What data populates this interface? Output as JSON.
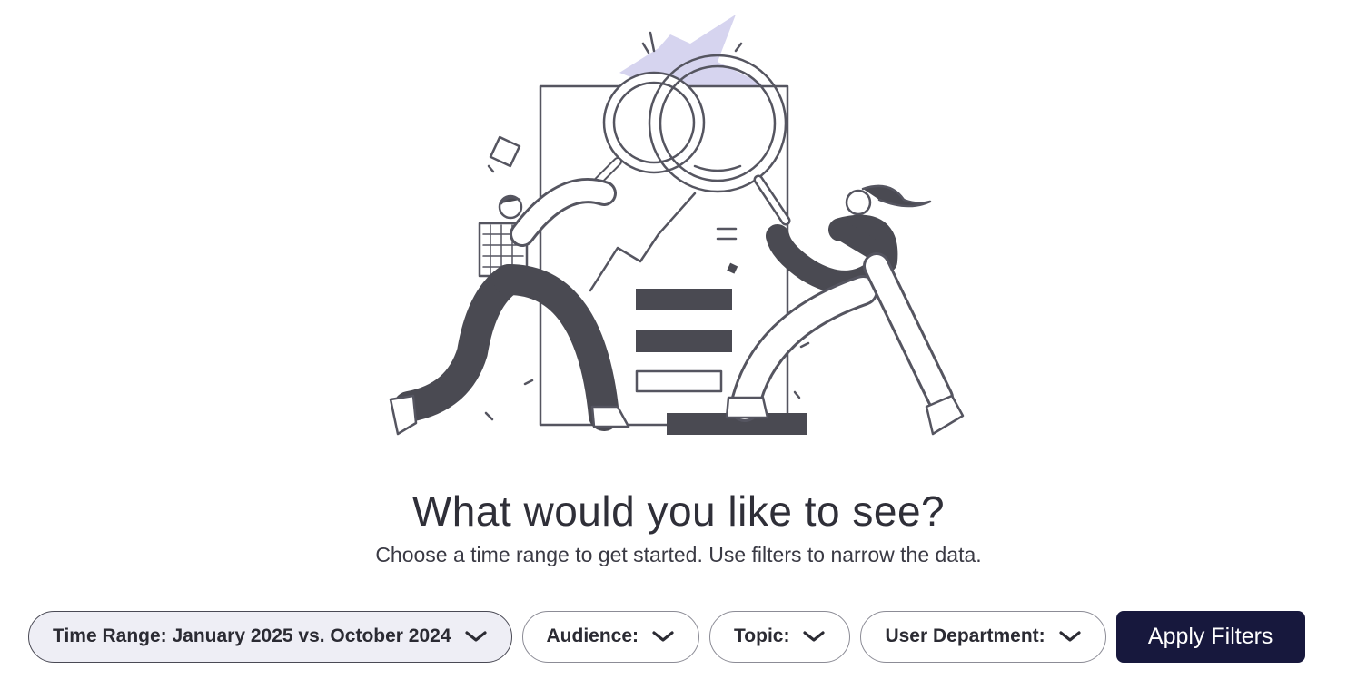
{
  "main": {
    "headline": "What would you like to see?",
    "subline": "Choose a time range to get started. Use filters to narrow the data."
  },
  "filters": {
    "time_range": "Time Range: January 2025 vs. October 2024",
    "audience": "Audience:",
    "topic": "Topic:",
    "user_department": "User Department:",
    "apply": "Apply Filters"
  },
  "colors": {
    "primary_button": "#17183d",
    "accent_burst": "#d6d4ef",
    "illustration_ink": "#4a4a52"
  }
}
